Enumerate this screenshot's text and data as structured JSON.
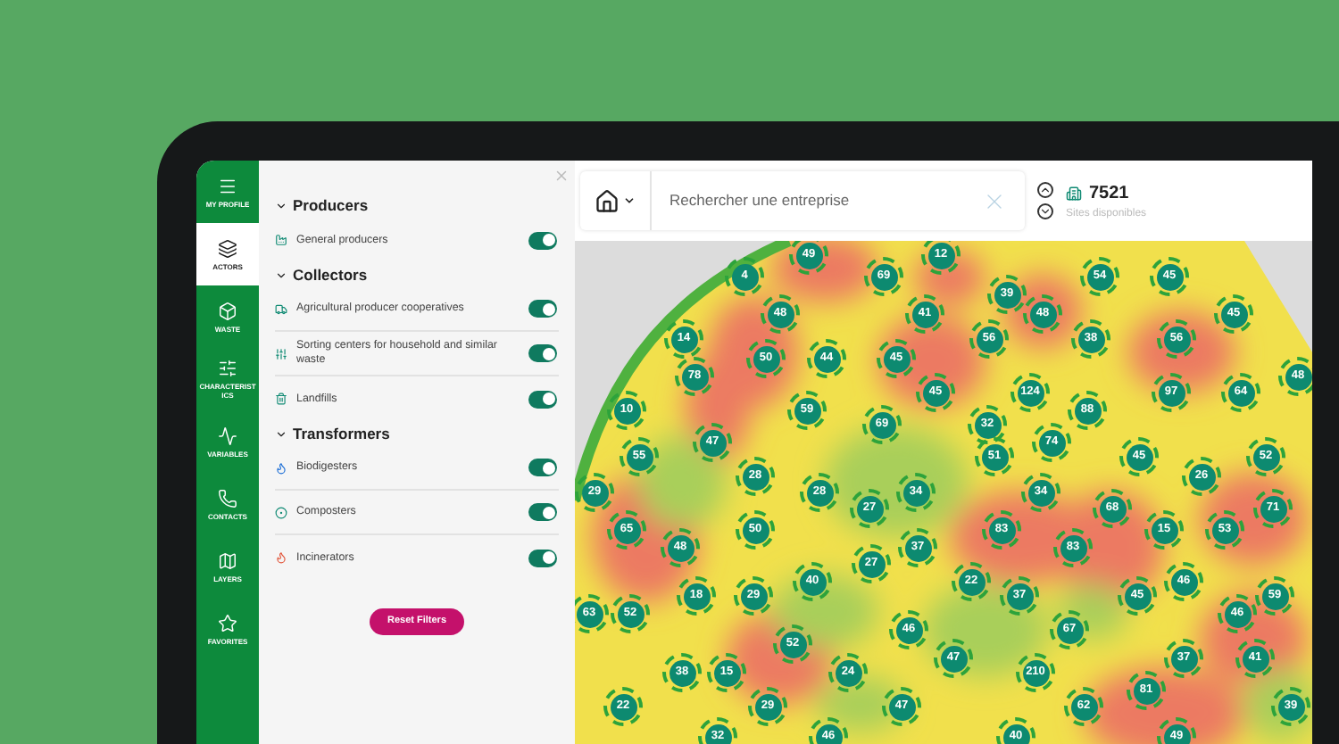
{
  "sidebar": {
    "items": [
      {
        "label": "MY PROFILE",
        "selected": false
      },
      {
        "label": "ACTORS",
        "selected": true
      },
      {
        "label": "WASTE",
        "selected": false
      },
      {
        "label": "CHARACTERISTICS",
        "selected": false
      },
      {
        "label": "VARIABLES",
        "selected": false
      },
      {
        "label": "CONTACTS",
        "selected": false
      },
      {
        "label": "LAYERS",
        "selected": false
      },
      {
        "label": "FAVORITES",
        "selected": false
      }
    ]
  },
  "filters": {
    "sections": [
      {
        "title": "Producers",
        "expanded": true,
        "items": [
          {
            "label": "General producers",
            "on": true
          }
        ]
      },
      {
        "title": "Collectors",
        "expanded": true,
        "items": [
          {
            "label": "Agricultural producer cooperatives",
            "on": true
          },
          {
            "label": "Sorting centers for household and similar waste",
            "on": true
          },
          {
            "label": "Landfills",
            "on": true
          }
        ]
      },
      {
        "title": "Transformers",
        "expanded": true,
        "items": [
          {
            "label": "Biodigesters",
            "on": true
          },
          {
            "label": "Composters",
            "on": true
          },
          {
            "label": "Incinerators",
            "on": true
          }
        ]
      }
    ],
    "reset_button": "Reset Filters"
  },
  "search": {
    "placeholder": "Rechercher une entreprise"
  },
  "sites": {
    "count": "7521",
    "label": "Sites disponibles"
  },
  "map": {
    "clusters": [
      "49",
      "12",
      "4",
      "69",
      "54",
      "45",
      "39",
      "48",
      "41",
      "48",
      "45",
      "14",
      "56",
      "38",
      "56",
      "50",
      "44",
      "45",
      "78",
      "48",
      "45",
      "124",
      "97",
      "64",
      "10",
      "59",
      "88",
      "69",
      "32",
      "47",
      "74",
      "55",
      "51",
      "45",
      "52",
      "28",
      "26",
      "29",
      "28",
      "34",
      "34",
      "27",
      "68",
      "71",
      "65",
      "50",
      "83",
      "15",
      "53",
      "48",
      "37",
      "83",
      "27",
      "40",
      "22",
      "46",
      "18",
      "29",
      "37",
      "45",
      "59",
      "63",
      "52",
      "46",
      "46",
      "67",
      "52",
      "47",
      "37",
      "41",
      "38",
      "15",
      "24",
      "210",
      "81",
      "22",
      "29",
      "47",
      "62",
      "39",
      "32",
      "46",
      "40",
      "49"
    ]
  }
}
